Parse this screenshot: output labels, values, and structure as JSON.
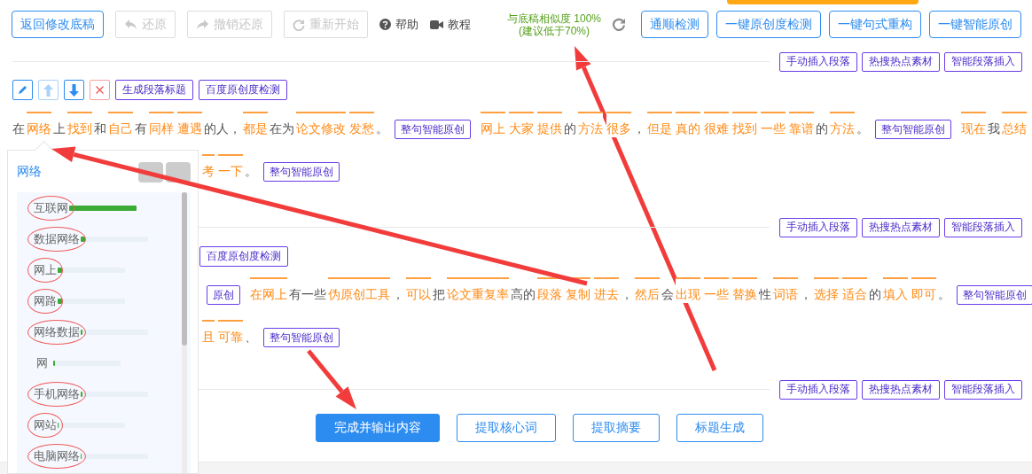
{
  "toolbar": {
    "buttons": [
      {
        "label": "返回修改底稿",
        "kind": "primary",
        "disabled": false
      },
      {
        "label": "还原",
        "kind": "undo",
        "disabled": true
      },
      {
        "label": "撤销还原",
        "kind": "redo",
        "disabled": true
      },
      {
        "label": "重新开始",
        "kind": "restart",
        "disabled": true
      }
    ],
    "links": [
      {
        "label": "帮助",
        "kind": "help"
      },
      {
        "label": "教程",
        "kind": "video"
      }
    ],
    "similarity": {
      "text": "与底稿相似度 100%",
      "hint": "(建议低于70%)"
    },
    "actions": [
      "通顺检测",
      "一键原创度检测",
      "一键句式重构",
      "一键智能原创"
    ]
  },
  "blocks": [
    {
      "kind": "insert_bar",
      "buttons": [
        "手动插入段落",
        "热搜热点素材",
        "智能段落插入"
      ]
    },
    {
      "kind": "paragraph",
      "tools": [
        {
          "kind": "edit",
          "disabled": false
        },
        {
          "kind": "up",
          "disabled": true
        },
        {
          "kind": "down",
          "disabled": false
        },
        {
          "kind": "delete",
          "disabled": false
        },
        {
          "kind": "text",
          "label": "生成段落标题"
        },
        {
          "kind": "text",
          "label": "百度原创度检测"
        }
      ],
      "tools_covered": false,
      "lines": [
        {
          "partly_covered": false,
          "segments": [
            {
              "kind": "plain",
              "t": "在"
            },
            {
              "kind": "word",
              "t": "网络"
            },
            {
              "kind": "plain",
              "t": "上"
            },
            {
              "kind": "word",
              "t": "找到"
            },
            {
              "kind": "plain",
              "t": "和"
            },
            {
              "kind": "word",
              "t": "自己"
            },
            {
              "kind": "plain",
              "t": "有"
            },
            {
              "kind": "word",
              "t": "同样"
            },
            {
              "kind": "word",
              "t": "遭遇"
            },
            {
              "kind": "plain",
              "t": "的人，"
            },
            {
              "kind": "word",
              "t": "都是"
            },
            {
              "kind": "plain",
              "t": "在为"
            },
            {
              "kind": "word",
              "t": "论文修改"
            },
            {
              "kind": "word",
              "t": "发愁"
            },
            {
              "kind": "plain",
              "t": "。"
            },
            {
              "kind": "button",
              "t": "整句智能原创"
            },
            {
              "kind": "word",
              "t": "网上"
            },
            {
              "kind": "word",
              "t": "大家"
            },
            {
              "kind": "word",
              "t": "提供"
            },
            {
              "kind": "plain",
              "t": "的"
            },
            {
              "kind": "word",
              "t": "方法"
            },
            {
              "kind": "word",
              "t": "很多"
            },
            {
              "kind": "plain",
              "t": "，"
            },
            {
              "kind": "word",
              "t": "但是"
            },
            {
              "kind": "word",
              "t": "真的"
            },
            {
              "kind": "word",
              "t": "很难"
            },
            {
              "kind": "word",
              "t": "找到"
            },
            {
              "kind": "word",
              "t": "一些"
            },
            {
              "kind": "word",
              "t": "靠谱"
            },
            {
              "kind": "plain",
              "t": "的"
            },
            {
              "kind": "word",
              "t": "方法"
            },
            {
              "kind": "plain",
              "t": "。"
            },
            {
              "kind": "button",
              "t": "整句智能原创"
            },
            {
              "kind": "word",
              "t": "现在"
            },
            {
              "kind": "plain",
              "t": "我"
            },
            {
              "kind": "word",
              "t": "总结"
            }
          ]
        },
        {
          "partly_covered": true,
          "segments": [
            {
              "kind": "word",
              "t": "考"
            },
            {
              "kind": "word",
              "t": "一下"
            },
            {
              "kind": "plain",
              "t": "。"
            },
            {
              "kind": "button",
              "t": "整句智能原创"
            }
          ]
        }
      ]
    },
    {
      "kind": "insert_bar",
      "buttons": [
        "手动插入段落",
        "热搜热点素材",
        "智能段落插入"
      ]
    },
    {
      "kind": "paragraph",
      "tools": [
        {
          "kind": "text",
          "label": "百度原创度检测"
        }
      ],
      "tools_covered": true,
      "lines": [
        {
          "partly_covered": true,
          "segments": [
            {
              "kind": "button",
              "t": "原创"
            },
            {
              "kind": "word",
              "t": "在网上"
            },
            {
              "kind": "plain",
              "t": "有一些"
            },
            {
              "kind": "word",
              "t": "伪原创工具"
            },
            {
              "kind": "plain",
              "t": "，"
            },
            {
              "kind": "word",
              "t": "可以"
            },
            {
              "kind": "plain",
              "t": "把"
            },
            {
              "kind": "word",
              "t": "论文重复率"
            },
            {
              "kind": "plain",
              "t": "高的"
            },
            {
              "kind": "word",
              "t": "段落"
            },
            {
              "kind": "word",
              "t": "复制"
            },
            {
              "kind": "word",
              "t": "进去"
            },
            {
              "kind": "plain",
              "t": "，"
            },
            {
              "kind": "word",
              "t": "然后"
            },
            {
              "kind": "plain",
              "t": "会"
            },
            {
              "kind": "word",
              "t": "出现"
            },
            {
              "kind": "word",
              "t": "一些"
            },
            {
              "kind": "word",
              "t": "替换"
            },
            {
              "kind": "plain",
              "t": "性"
            },
            {
              "kind": "word",
              "t": "词语"
            },
            {
              "kind": "plain",
              "t": "，"
            },
            {
              "kind": "word",
              "t": "选择"
            },
            {
              "kind": "word",
              "t": "适合"
            },
            {
              "kind": "plain",
              "t": "的"
            },
            {
              "kind": "word",
              "t": "填入"
            },
            {
              "kind": "word",
              "t": "即可"
            },
            {
              "kind": "plain",
              "t": "。"
            },
            {
              "kind": "button",
              "t": "整句智能原创"
            }
          ]
        },
        {
          "partly_covered": true,
          "segments": [
            {
              "kind": "word",
              "t": "且"
            },
            {
              "kind": "word",
              "t": "可靠"
            },
            {
              "kind": "plain",
              "t": "、"
            },
            {
              "kind": "button",
              "t": "整句智能原创"
            }
          ]
        }
      ]
    },
    {
      "kind": "insert_bar",
      "buttons": [
        "手动插入段落",
        "热搜热点素材",
        "智能段落插入"
      ]
    }
  ],
  "bottom_buttons": [
    {
      "label": "完成并输出内容",
      "kind": "primary"
    },
    {
      "label": "提取核心词",
      "kind": "outline"
    },
    {
      "label": "提取摘要",
      "kind": "outline"
    },
    {
      "label": "标题生成",
      "kind": "outline"
    }
  ],
  "suggestions": {
    "word": "网络",
    "items": [
      {
        "label": "互联网",
        "level": 1,
        "circled": true
      },
      {
        "label": "数据网络",
        "level": 0.07,
        "circled": true
      },
      {
        "label": "网上",
        "level": 0.07,
        "circled": true
      },
      {
        "label": "网路",
        "level": 0.06,
        "circled": true
      },
      {
        "label": "网络数据",
        "level": 0.03,
        "circled": true
      },
      {
        "label": "网",
        "level": 0.025,
        "circled": false
      },
      {
        "label": "手机网络",
        "level": 0.025,
        "circled": true
      },
      {
        "label": "网站",
        "level": 0.015,
        "circled": true
      },
      {
        "label": "电脑网络",
        "level": 0.015,
        "circled": true
      }
    ]
  }
}
